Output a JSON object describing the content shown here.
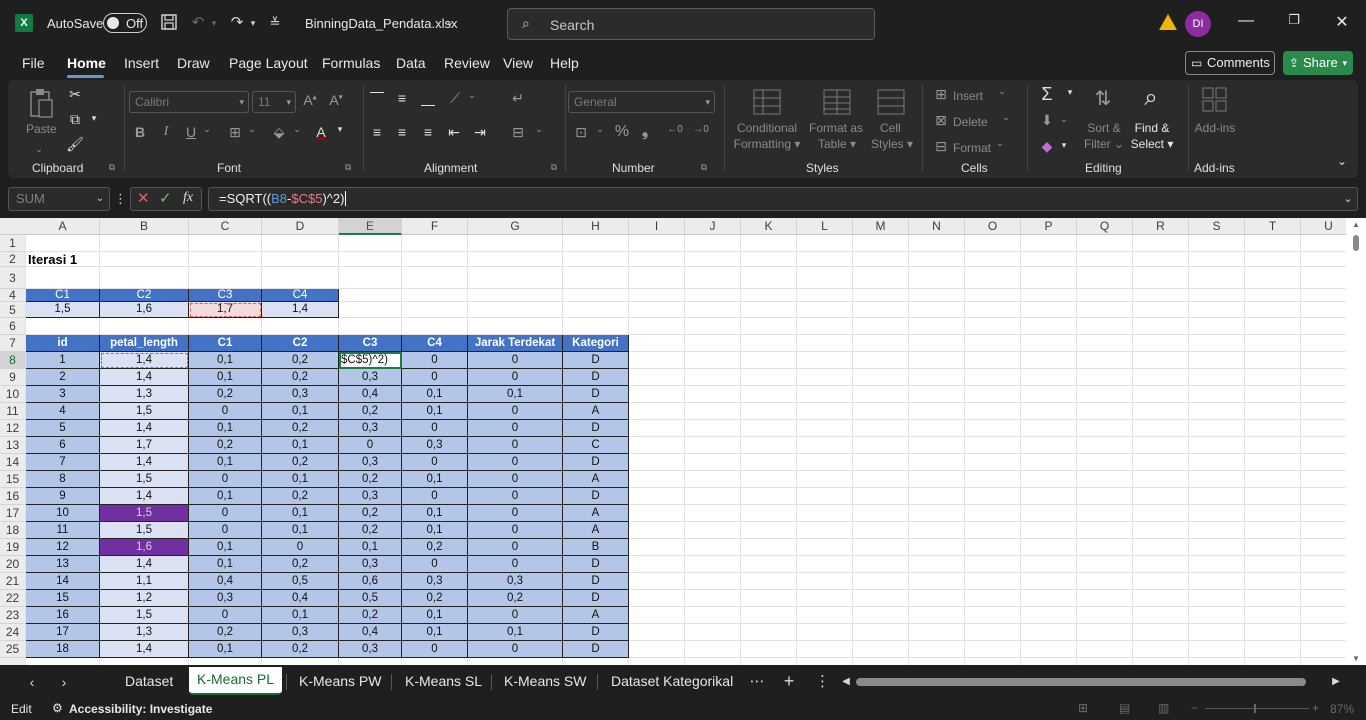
{
  "titlebar": {
    "autosave_label": "AutoSave",
    "autosave_state": "Off",
    "filename": "BinningData_Pendata.xlsx",
    "search_placeholder": "Search",
    "user_initials": "DI"
  },
  "menu": {
    "items": [
      "File",
      "Home",
      "Insert",
      "Draw",
      "Page Layout",
      "Formulas",
      "Data",
      "Review",
      "View",
      "Help"
    ],
    "active": "Home",
    "comments_label": "Comments",
    "share_label": "Share"
  },
  "ribbon": {
    "clipboard": {
      "label": "Clipboard",
      "paste": "Paste"
    },
    "font": {
      "label": "Font",
      "font_name": "Calibri",
      "font_size": "11"
    },
    "alignment": {
      "label": "Alignment"
    },
    "number": {
      "label": "Number",
      "format": "General"
    },
    "styles": {
      "label": "Styles",
      "conditional_1": "Conditional",
      "conditional_2": "Formatting",
      "format_table_1": "Format as",
      "format_table_2": "Table",
      "cell_styles_1": "Cell",
      "cell_styles_2": "Styles"
    },
    "cells": {
      "label": "Cells",
      "insert": "Insert",
      "delete": "Delete",
      "format": "Format"
    },
    "editing": {
      "label": "Editing",
      "sort_1": "Sort &",
      "sort_2": "Filter",
      "find_1": "Find &",
      "find_2": "Select"
    },
    "addins": {
      "label": "Add-ins",
      "addins": "Add-ins"
    }
  },
  "formula_bar": {
    "name_box": "SUM",
    "formula_prefix": "=SQRT((",
    "ref1": "B8",
    "minus": "-",
    "ref2": "$C$5",
    "formula_suffix": ")^2)"
  },
  "columns": [
    "A",
    "B",
    "C",
    "D",
    "E",
    "F",
    "G",
    "H",
    "I",
    "J",
    "K",
    "L",
    "M",
    "N",
    "O",
    "P",
    "Q",
    "R",
    "S",
    "T",
    "U"
  ],
  "rows": [
    "1",
    "2",
    "3",
    "4",
    "5",
    "6",
    "7",
    "8",
    "9",
    "10",
    "11",
    "12",
    "13",
    "14",
    "15",
    "16",
    "17",
    "18",
    "19",
    "20",
    "21",
    "22",
    "23",
    "24",
    "25"
  ],
  "sheet": {
    "title": "Iterasi 1",
    "centroid_headers": [
      "C1",
      "C2",
      "C3",
      "C4"
    ],
    "centroid_values": [
      "1,5",
      "1,6",
      "1,7",
      "1,4"
    ],
    "table_headers": [
      "id",
      "petal_length",
      "C1",
      "C2",
      "C3",
      "C4",
      "Jarak Terdekat",
      "Kategori"
    ],
    "editing_cell_text": "$C$5)^2)",
    "table_rows": [
      [
        "1",
        "1,4",
        "0,1",
        "0,2",
        "",
        "0",
        "0",
        "D"
      ],
      [
        "2",
        "1,4",
        "0,1",
        "0,2",
        "0,3",
        "0",
        "0",
        "D"
      ],
      [
        "3",
        "1,3",
        "0,2",
        "0,3",
        "0,4",
        "0,1",
        "0,1",
        "D"
      ],
      [
        "4",
        "1,5",
        "0",
        "0,1",
        "0,2",
        "0,1",
        "0",
        "A"
      ],
      [
        "5",
        "1,4",
        "0,1",
        "0,2",
        "0,3",
        "0",
        "0",
        "D"
      ],
      [
        "6",
        "1,7",
        "0,2",
        "0,1",
        "0",
        "0,3",
        "0",
        "C"
      ],
      [
        "7",
        "1,4",
        "0,1",
        "0,2",
        "0,3",
        "0",
        "0",
        "D"
      ],
      [
        "8",
        "1,5",
        "0",
        "0,1",
        "0,2",
        "0,1",
        "0",
        "A"
      ],
      [
        "9",
        "1,4",
        "0,1",
        "0,2",
        "0,3",
        "0",
        "0",
        "D"
      ],
      [
        "10",
        "1,5",
        "0",
        "0,1",
        "0,2",
        "0,1",
        "0",
        "A"
      ],
      [
        "11",
        "1,5",
        "0",
        "0,1",
        "0,2",
        "0,1",
        "0",
        "A"
      ],
      [
        "12",
        "1,6",
        "0,1",
        "0",
        "0,1",
        "0,2",
        "0",
        "B"
      ],
      [
        "13",
        "1,4",
        "0,1",
        "0,2",
        "0,3",
        "0",
        "0",
        "D"
      ],
      [
        "14",
        "1,1",
        "0,4",
        "0,5",
        "0,6",
        "0,3",
        "0,3",
        "D"
      ],
      [
        "15",
        "1,2",
        "0,3",
        "0,4",
        "0,5",
        "0,2",
        "0,2",
        "D"
      ],
      [
        "16",
        "1,5",
        "0",
        "0,1",
        "0,2",
        "0,1",
        "0",
        "A"
      ],
      [
        "17",
        "1,3",
        "0,2",
        "0,3",
        "0,4",
        "0,1",
        "0,1",
        "D"
      ],
      [
        "18",
        "1,4",
        "0,1",
        "0,2",
        "0,3",
        "0",
        "0",
        "D"
      ]
    ],
    "highlight_purple_ids": [
      "10",
      "12"
    ]
  },
  "tabs": {
    "items": [
      "Dataset",
      "K-Means PL",
      "K-Means PW",
      "K-Means SL",
      "K-Means SW",
      "Dataset Kategorikal"
    ],
    "active": "K-Means PL"
  },
  "status": {
    "mode": "Edit",
    "accessibility": "Accessibility: Investigate",
    "zoom": "87%"
  },
  "colors": {
    "header_blue": "#4472c4",
    "row_light": "#b4c6e7",
    "row_lighter": "#d9e1f2",
    "purple": "#7030a0",
    "excel_green": "#107c41"
  }
}
